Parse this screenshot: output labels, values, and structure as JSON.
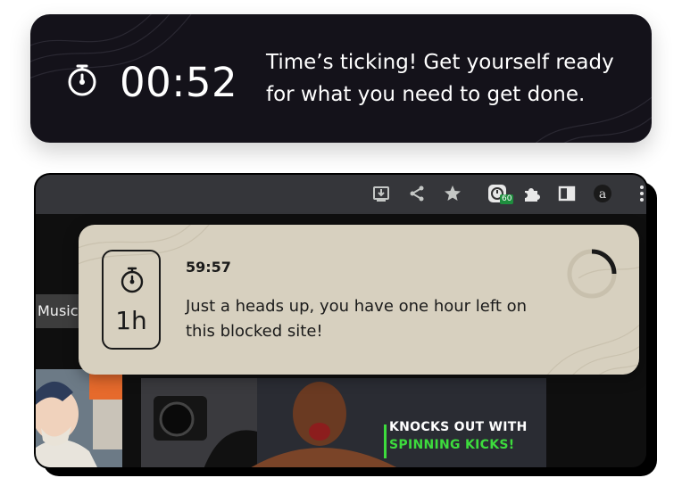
{
  "banner": {
    "countdown": "00:52",
    "message": "Time’s ticking! Get yourself ready for what you need to get done.",
    "icon": "stopwatch-icon"
  },
  "browser": {
    "toolbar_icons": [
      "install-icon",
      "share-icon",
      "bookmark-star-icon",
      "extension-timer-icon",
      "puzzle-extensions-icon",
      "side-panel-icon",
      "profile-icon",
      "kebab-menu-icon"
    ],
    "extension_badge": "60",
    "chip_label": "Music",
    "thumbnail_caption_line1": "KNOCKS OUT WITH",
    "thumbnail_caption_line2": "SPINNING KICKS!"
  },
  "notification": {
    "badge_label": "1h",
    "elapsed": "59:57",
    "message": "Just a heads up, you have one hour left on this blocked site!",
    "spinner_progress": 0.25
  },
  "colors": {
    "banner_bg": "#14121a",
    "notification_bg": "#d7d0bf",
    "badge_green": "#1e8e3e",
    "caption_green": "#3ddc3d"
  }
}
